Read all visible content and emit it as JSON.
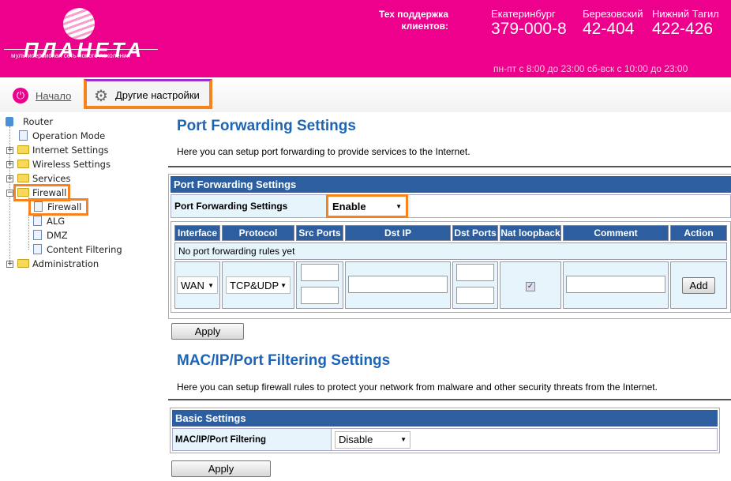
{
  "header": {
    "logo_text": "ПЛАНЕТА",
    "logo_tagline": "мультисервисная сеть нового поколения",
    "support_label": "Тех поддержка клиентов:",
    "contacts": [
      {
        "city": "Екатеринбург",
        "phone": "379-000-8"
      },
      {
        "city": "Березовский",
        "phone": "42-404"
      },
      {
        "city": "Нижний Тагил",
        "phone": "422-426"
      }
    ],
    "hours": "пн-пт с 8:00 до 23:00 сб-вск с 10:00 до 23:00",
    "brand_color": "#EC008C"
  },
  "nav": {
    "home": "Начало",
    "other_settings": "Другие настройки"
  },
  "sidebar": {
    "root": "Router",
    "items": [
      "Operation Mode",
      "Internet Settings",
      "Wireless Settings",
      "Services",
      "Firewall",
      "Firewall",
      "ALG",
      "DMZ",
      "Content Filtering",
      "Administration"
    ]
  },
  "port_forwarding": {
    "title": "Port Forwarding Settings",
    "description": "Here you can setup port forwarding to provide services to the Internet.",
    "section_header": "Port Forwarding Settings",
    "setting_label": "Port Forwarding Settings",
    "setting_value": "Enable",
    "columns": [
      "Interface",
      "Protocol",
      "Src Ports",
      "Dst IP",
      "Dst Ports",
      "Nat loopback",
      "Comment",
      "Action"
    ],
    "empty_message": "No port forwarding rules yet",
    "new_rule": {
      "interface": "WAN",
      "protocol": "TCP&UDP",
      "nat_loopback": true
    },
    "add_label": "Add",
    "apply_label": "Apply"
  },
  "mac_filter": {
    "title": "MAC/IP/Port Filtering Settings",
    "description": "Here you can setup firewall rules to protect your network from malware and other security threats from the Internet.",
    "section_header": "Basic Settings",
    "setting_label": "MAC/IP/Port Filtering",
    "setting_value": "Disable",
    "apply_label": "Apply"
  }
}
